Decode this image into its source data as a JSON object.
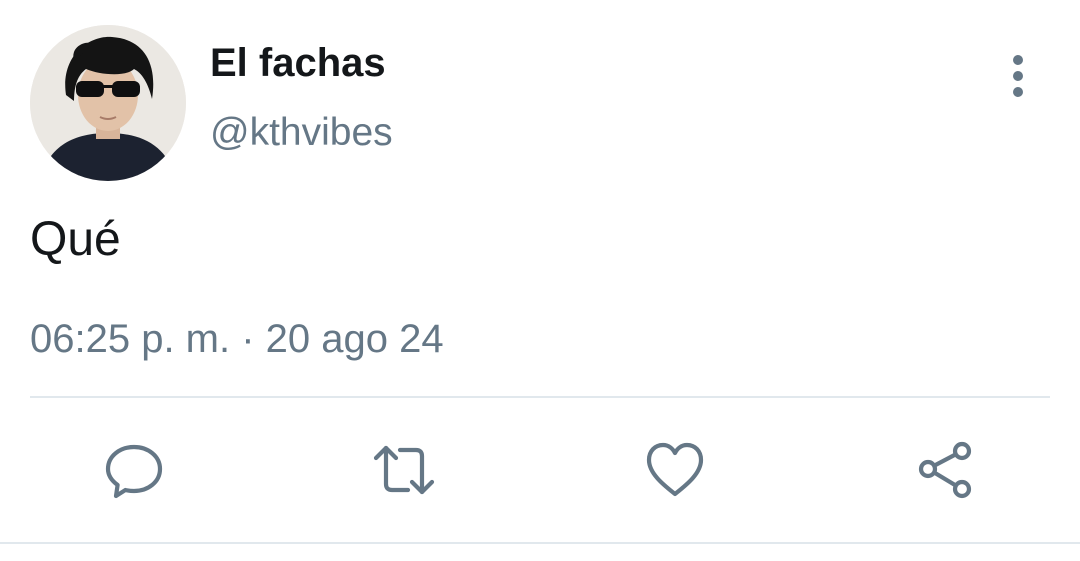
{
  "tweet": {
    "author": {
      "display_name": "El fachas",
      "handle": "@kthvibes",
      "avatar": "avatar-photo"
    },
    "text": "Qué",
    "timestamp": "06:25 p. m. · 20 ago 24",
    "menu_icon": "more-vertical-icon",
    "actions": [
      {
        "name": "reply",
        "icon": "reply-icon"
      },
      {
        "name": "retweet",
        "icon": "retweet-icon"
      },
      {
        "name": "like",
        "icon": "heart-icon"
      },
      {
        "name": "share",
        "icon": "share-icon"
      }
    ]
  },
  "colors": {
    "text_primary": "#14171a",
    "text_secondary": "#657786",
    "icon": "#657786",
    "divider": "#e1e8ed",
    "background": "#ffffff"
  }
}
